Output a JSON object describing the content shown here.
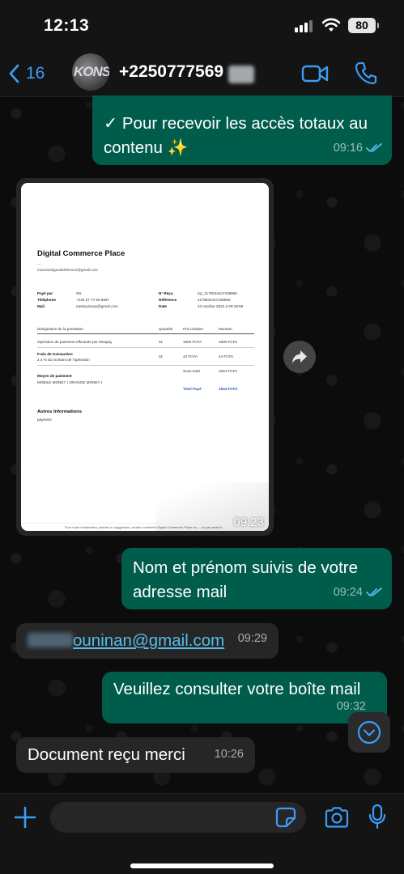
{
  "status_bar": {
    "time": "12:13",
    "battery": "80"
  },
  "header": {
    "back_count": "16",
    "contact_name": "+2250777569",
    "avatar_text": "KONS"
  },
  "messages": [
    {
      "direction": "out",
      "text": "✓ Pour recevoir les accès totaux au contenu ✨",
      "time": "09:16"
    },
    {
      "direction": "out",
      "type": "image",
      "time": "09:23"
    },
    {
      "direction": "out",
      "text": "Nom et prénom suivis de votre adresse mail",
      "time": "09:24"
    },
    {
      "direction": "in",
      "text": "ouninan@gmail.com",
      "time": "09:29"
    },
    {
      "direction": "out",
      "text": "Veuillez consulter votre boîte mail",
      "time": "09:32"
    },
    {
      "direction": "in",
      "text": "Document reçu merci",
      "time": "10:26"
    }
  ],
  "receipt": {
    "title": "Digital Commerce Place",
    "dots": "...",
    "email": "moraniologoudelebenon@gmail.com",
    "payer_label": "Payé par",
    "payer_value": "SN",
    "phone_label": "Téléphone",
    "phone_value": "+225 07 77 56 9567",
    "mail_label": "Mail",
    "mail_value": "nastiouninan@gmail.com",
    "receipt_label": "N° Reçu",
    "receipt_value": "icp_1170534447158860",
    "reference_label": "Référence",
    "reference_value": "1178934447158868",
    "date_label": "Date",
    "date_value": "23 octobre 2024 à 09:19:59",
    "col_designation": "Désignation de la prestation",
    "col_quantity": "Quantité",
    "col_unit_price": "Prix Unitaire",
    "col_amount": "Montant",
    "row1_label": "Opération de paiement effectuée par Kkiapay",
    "row1_qty": "01",
    "row1_price": "1800 FCFA",
    "row1_amount": "1800 FCFA",
    "row2_label": "Frais de transaction",
    "row2_sub": "2.4 % du montant de l'opération",
    "row2_qty": "01",
    "row2_price": "44 FCFA",
    "row2_amount": "44 FCFA",
    "subtotal_label": "Sous-total",
    "subtotal_value": "1844 FCFA",
    "payment_method_label": "Moyen de paiement",
    "payment_method_value": "MOBILE MONEY ( ORANGE MONEY )",
    "total_label": "Total Payé",
    "total_value": "1844 FCFA",
    "other_info_label": "Autres Informations",
    "other_info_value": "payment",
    "footer": "Pour toute réclamation, plainte ou suggestion, veuillez contacter Digital Commerce Place au ... ou par email à ..."
  },
  "colors": {
    "accent": "#3b9cf6",
    "outgoing_bubble": "#005c4b",
    "incoming_bubble": "#262626",
    "read_ticks": "#53bdeb"
  },
  "composer": {
    "placeholder": ""
  }
}
